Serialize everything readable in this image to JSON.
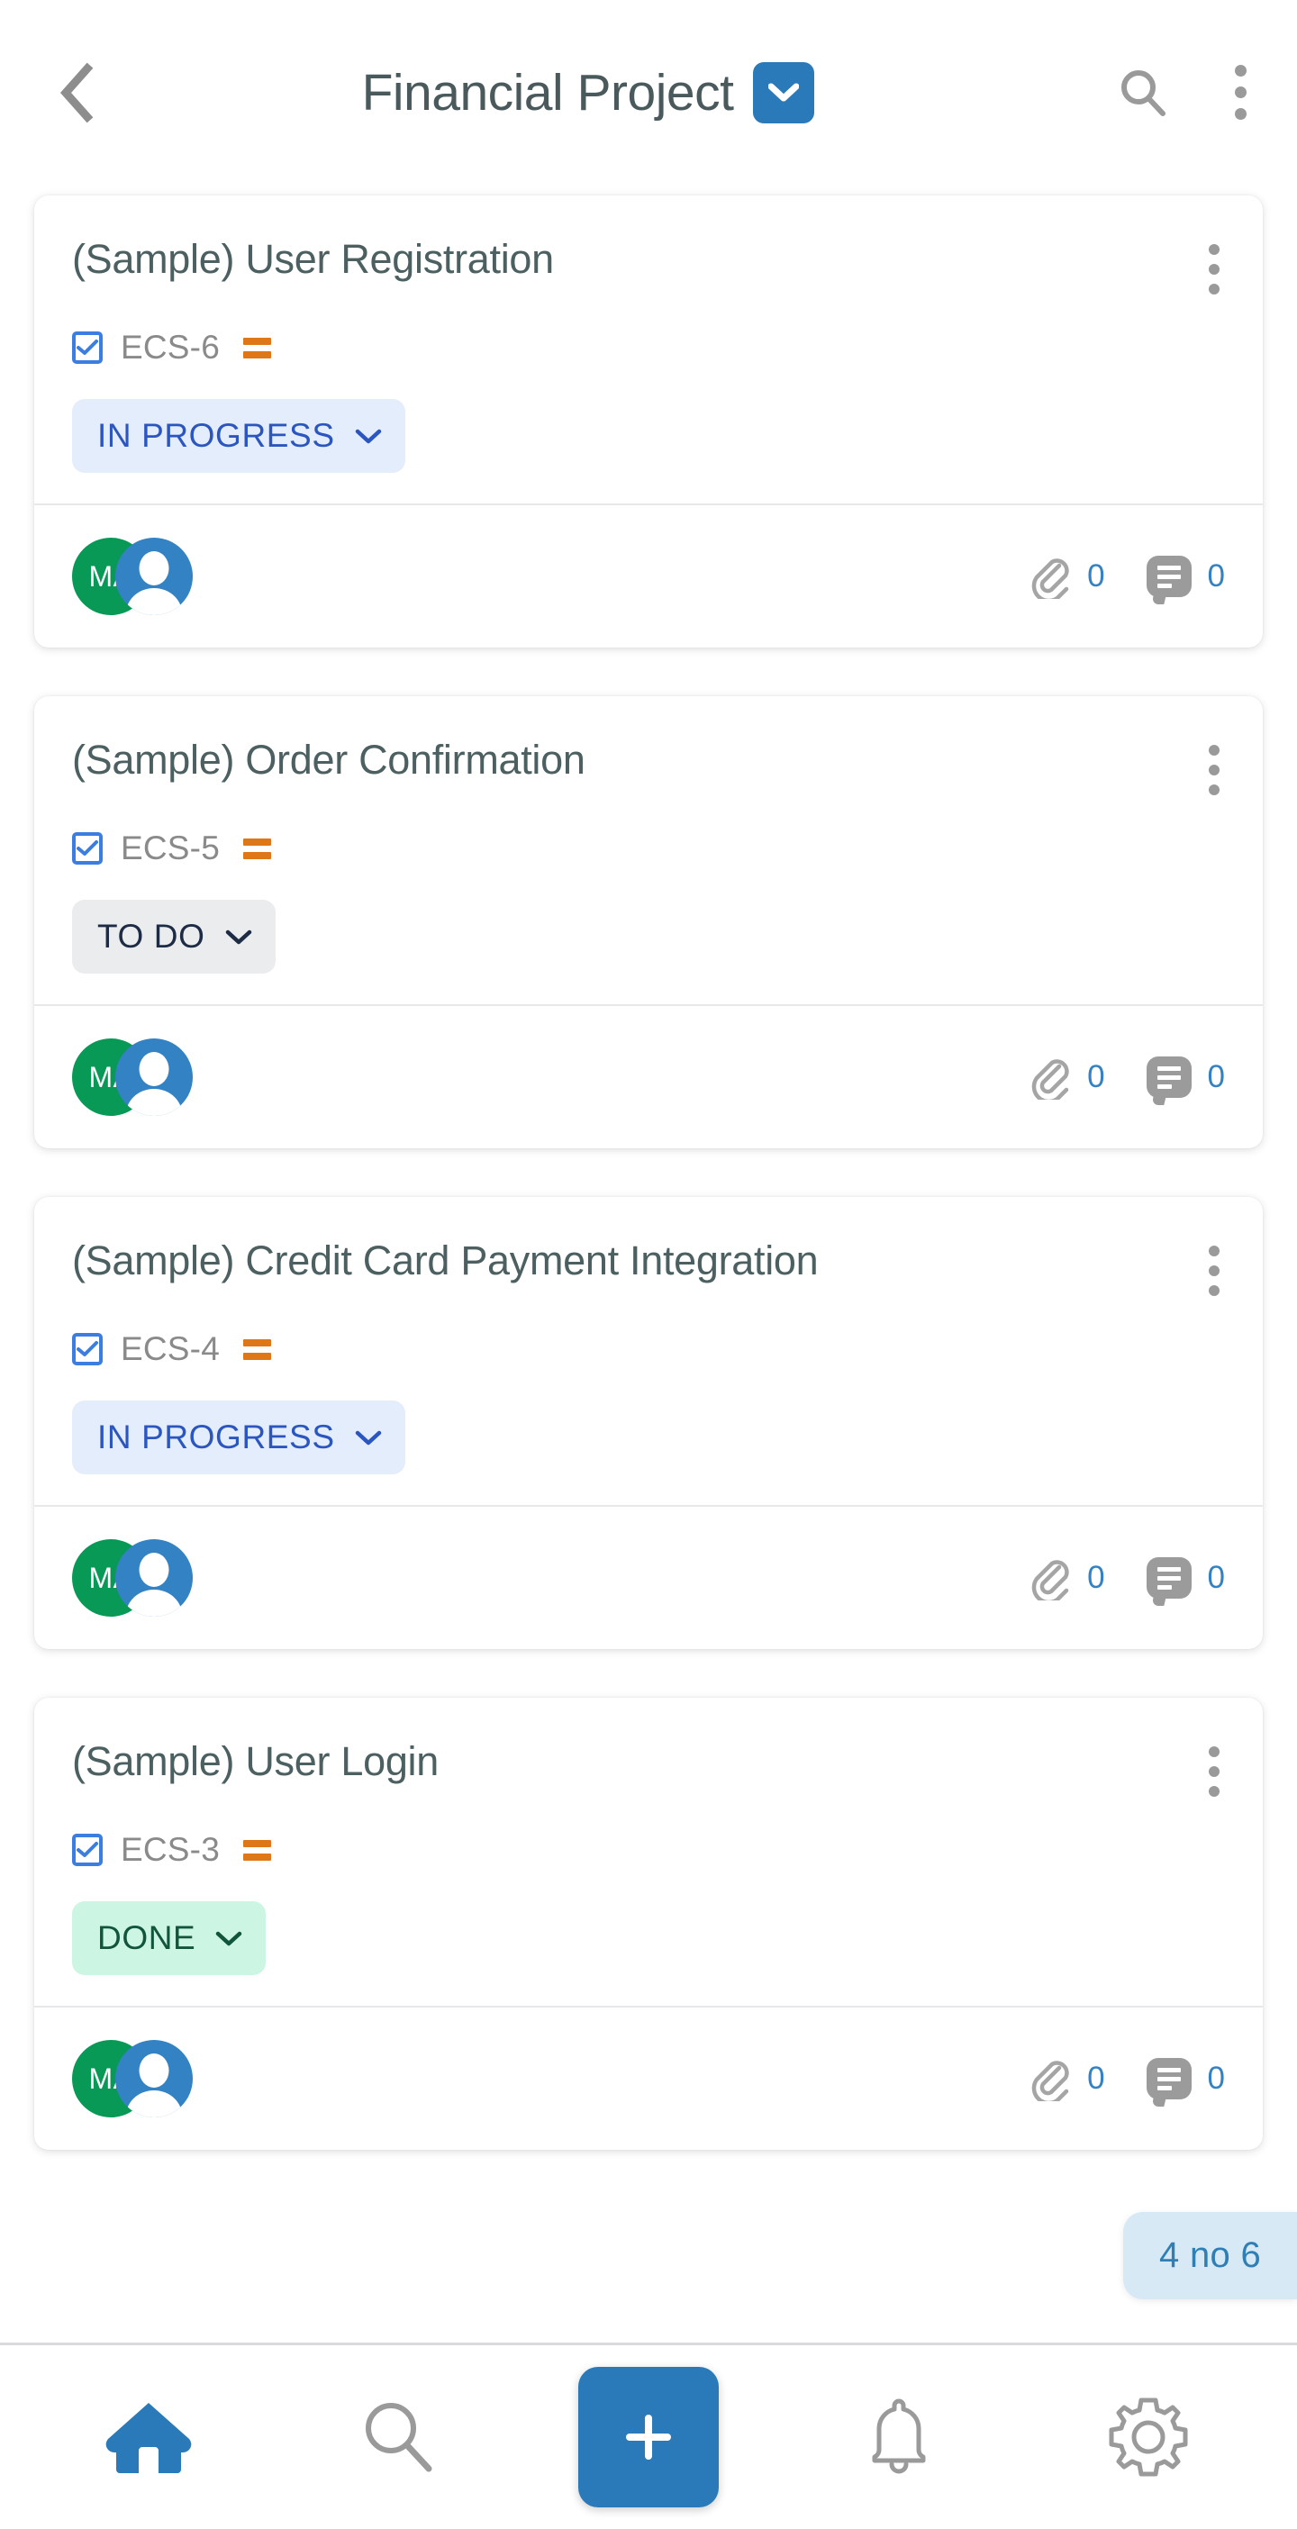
{
  "header": {
    "back_icon": "chevron-left-icon",
    "title": "Financial Project",
    "dropdown_icon": "chevron-down-icon",
    "search_icon": "search-icon",
    "more_icon": "more-vertical-icon",
    "accent_color": "#2a7ab9",
    "title_color": "#4a5a5c"
  },
  "cards": [
    {
      "title": "(Sample) User Registration",
      "issue_key": "ECS-6",
      "priority_icon": "medium-priority-icon",
      "priority_color": "#de7718",
      "checkbox_icon": "checkbox-checked-icon",
      "status": "IN PROGRESS",
      "status_kind": "inprogress",
      "status_chevron_icon": "chevron-down-icon",
      "menu_icon": "more-vertical-icon",
      "avatar_initials": "MA",
      "avatar_color": "#089956",
      "avatar_second_icon": "person-avatar-icon",
      "attachment_icon": "paperclip-icon",
      "attachment_count": "0",
      "comment_icon": "comment-icon",
      "comment_count": "0"
    },
    {
      "title": "(Sample) Order Confirmation",
      "issue_key": "ECS-5",
      "priority_icon": "medium-priority-icon",
      "priority_color": "#de7718",
      "checkbox_icon": "checkbox-checked-icon",
      "status": "TO DO",
      "status_kind": "todo",
      "status_chevron_icon": "chevron-down-icon",
      "menu_icon": "more-vertical-icon",
      "avatar_initials": "MA",
      "avatar_color": "#089956",
      "avatar_second_icon": "person-avatar-icon",
      "attachment_icon": "paperclip-icon",
      "attachment_count": "0",
      "comment_icon": "comment-icon",
      "comment_count": "0"
    },
    {
      "title": "(Sample) Credit Card Payment Integration",
      "issue_key": "ECS-4",
      "priority_icon": "medium-priority-icon",
      "priority_color": "#de7718",
      "checkbox_icon": "checkbox-checked-icon",
      "status": "IN PROGRESS",
      "status_kind": "inprogress",
      "status_chevron_icon": "chevron-down-icon",
      "menu_icon": "more-vertical-icon",
      "avatar_initials": "MA",
      "avatar_color": "#089956",
      "avatar_second_icon": "person-avatar-icon",
      "attachment_icon": "paperclip-icon",
      "attachment_count": "0",
      "comment_icon": "comment-icon",
      "comment_count": "0"
    },
    {
      "title": "(Sample) User Login",
      "issue_key": "ECS-3",
      "priority_icon": "medium-priority-icon",
      "priority_color": "#de7718",
      "checkbox_icon": "checkbox-checked-icon",
      "status": "DONE",
      "status_kind": "done",
      "status_chevron_icon": "chevron-down-icon",
      "menu_icon": "more-vertical-icon",
      "avatar_initials": "MA",
      "avatar_color": "#089956",
      "avatar_second_icon": "person-avatar-icon",
      "attachment_icon": "paperclip-icon",
      "attachment_count": "0",
      "comment_icon": "comment-icon",
      "comment_count": "0"
    }
  ],
  "float_pill": {
    "label": "4 no 6",
    "background": "#d7e9f5",
    "text_color": "#2f7fb5"
  },
  "bottom_nav": {
    "items": [
      {
        "icon": "home-icon",
        "active": true
      },
      {
        "icon": "search-icon",
        "active": false
      },
      {
        "icon": "plus-icon",
        "active": false
      },
      {
        "icon": "bell-icon",
        "active": false
      },
      {
        "icon": "gear-icon",
        "active": false
      }
    ],
    "active_color": "#2a7ab9",
    "inactive_color": "#9a9a9a"
  }
}
